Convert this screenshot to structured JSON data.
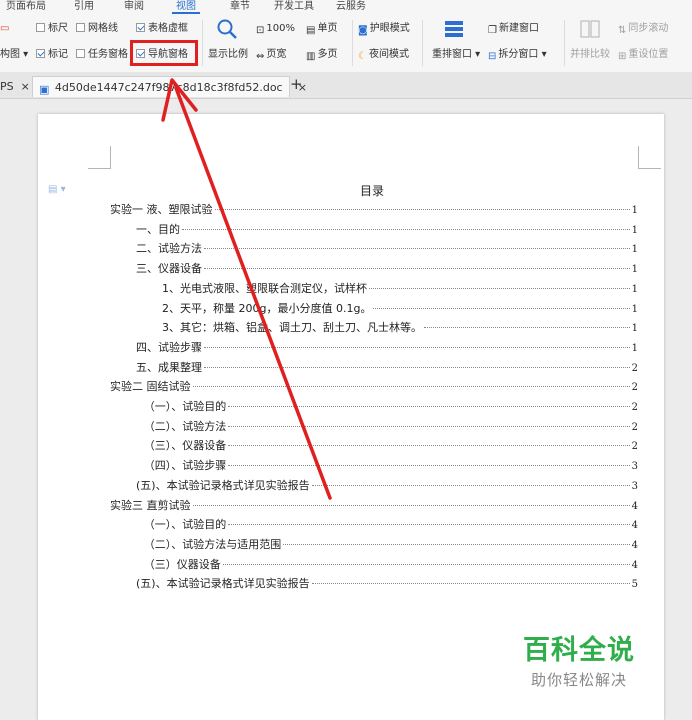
{
  "menubar": {
    "items": [
      "页面布局",
      "引用",
      "审阅",
      "视图",
      "章节",
      "开发工具",
      "云服务"
    ],
    "active_index": 3
  },
  "ribbon": {
    "ruler": "标尺",
    "gridlines": "网格线",
    "table_frame": "表格虚框",
    "outline_view": "构图",
    "mark": "标记",
    "task_pane": "任务窗格",
    "nav_pane": "导航窗格",
    "zoom_label": "显示比例",
    "zoom_percent": "100%",
    "page_width": "页宽",
    "single_page": "单页",
    "multi_page": "多页",
    "eye_mode": "护眼模式",
    "night_mode": "夜间模式",
    "rearrange_window": "重排窗口",
    "new_window": "新建窗口",
    "split_window": "拆分窗口",
    "side_by_side": "并排比较",
    "sync_scroll": "同步滚动",
    "reset_position": "重设位置"
  },
  "checkboxes": {
    "ruler": false,
    "gridlines": false,
    "table_frame": true,
    "mark": true,
    "task_pane": false,
    "nav_pane": true
  },
  "tabs": {
    "prev_tab": "PS",
    "doc_tab": "4d50de1447c247f987c8d18c3f8fd52.doc"
  },
  "document": {
    "title": "目录",
    "toc": [
      {
        "text": "实验一  液、塑限试验",
        "page": "1",
        "indent": 0
      },
      {
        "text": "一、目的",
        "page": "1",
        "indent": 1
      },
      {
        "text": "二、试验方法",
        "page": "1",
        "indent": 1
      },
      {
        "text": "三、仪器设备",
        "page": "1",
        "indent": 1
      },
      {
        "text": "1、光电式液限、塑限联合测定仪，试样杯",
        "page": "1",
        "indent": 2
      },
      {
        "text": "2、天平，称量 200g，最小分度值 0.1g。",
        "page": "1",
        "indent": 2
      },
      {
        "text": "3、其它：烘箱、铝盒、调土刀、刮土刀、凡士林等。",
        "page": "1",
        "indent": 2
      },
      {
        "text": "四、试验步骤",
        "page": "1",
        "indent": 1
      },
      {
        "text": "五、成果整理",
        "page": "2",
        "indent": 1
      },
      {
        "text": "实验二   固结试验",
        "page": "2",
        "indent": 0
      },
      {
        "text": "（一）、试验目的",
        "page": "2",
        "indent": 1.3
      },
      {
        "text": "（二）、试验方法",
        "page": "2",
        "indent": 1.3
      },
      {
        "text": "（三）、仪器设备",
        "page": "2",
        "indent": 1.3
      },
      {
        "text": "（四）、试验步骤",
        "page": "3",
        "indent": 1.3
      },
      {
        "text": "(五)、本试验记录格式详见实验报告",
        "page": "3",
        "indent": 1
      },
      {
        "text": "实验三     直剪试验",
        "page": "4",
        "indent": 0
      },
      {
        "text": "（一）、试验目的",
        "page": "4",
        "indent": 1.3
      },
      {
        "text": "（二）、试验方法与适用范围",
        "page": "4",
        "indent": 1.3
      },
      {
        "text": "（三）仪器设备",
        "page": "4",
        "indent": 1.3
      },
      {
        "text": "(五)、本试验记录格式详见实验报告",
        "page": "5",
        "indent": 1
      }
    ]
  },
  "watermark": {
    "brand": "百科全说",
    "slogan": "助你轻松解决"
  },
  "colors": {
    "accent": "#2a6fd1",
    "highlight": "#e02020",
    "watermark_green": "#2fae4b"
  }
}
